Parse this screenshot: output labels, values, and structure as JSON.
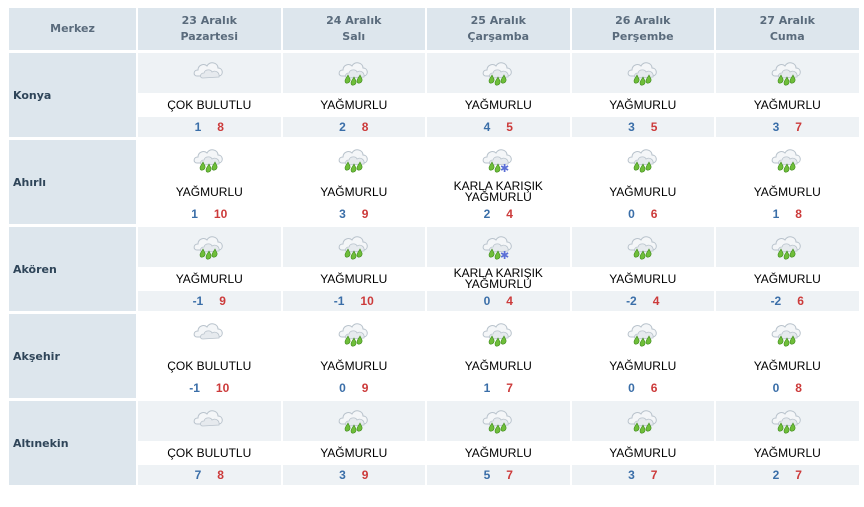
{
  "header": {
    "region": "Merkez",
    "days": [
      {
        "date": "23 Aralık",
        "weekday": "Pazartesi"
      },
      {
        "date": "24 Aralık",
        "weekday": "Salı"
      },
      {
        "date": "25 Aralık",
        "weekday": "Çarşamba"
      },
      {
        "date": "26 Aralık",
        "weekday": "Perşembe"
      },
      {
        "date": "27 Aralık",
        "weekday": "Cuma"
      }
    ]
  },
  "colors": {
    "header_bg": "#dde6ed",
    "shade_bg": "#eef2f5",
    "min": "#3a6ea8",
    "max": "#cc3a3a"
  },
  "rows": [
    {
      "name": "Konya",
      "days": [
        {
          "icon": "cloudy-icon",
          "condition": "ÇOK BULUTLU",
          "min": "1",
          "max": "8"
        },
        {
          "icon": "rain-icon",
          "condition": "YAĞMURLU",
          "min": "2",
          "max": "8"
        },
        {
          "icon": "rain-icon",
          "condition": "YAĞMURLU",
          "min": "4",
          "max": "5"
        },
        {
          "icon": "rain-icon",
          "condition": "YAĞMURLU",
          "min": "3",
          "max": "5"
        },
        {
          "icon": "rain-icon",
          "condition": "YAĞMURLU",
          "min": "3",
          "max": "7"
        }
      ]
    },
    {
      "name": "Ahırlı",
      "days": [
        {
          "icon": "rain-icon",
          "condition": "YAĞMURLU",
          "min": "1",
          "max": "10"
        },
        {
          "icon": "rain-icon",
          "condition": "YAĞMURLU",
          "min": "3",
          "max": "9"
        },
        {
          "icon": "sleet-icon",
          "condition": "KARLA KARIŞIK YAĞMURLU",
          "min": "2",
          "max": "4"
        },
        {
          "icon": "rain-icon",
          "condition": "YAĞMURLU",
          "min": "0",
          "max": "6"
        },
        {
          "icon": "rain-icon",
          "condition": "YAĞMURLU",
          "min": "1",
          "max": "8"
        }
      ]
    },
    {
      "name": "Akören",
      "days": [
        {
          "icon": "rain-icon",
          "condition": "YAĞMURLU",
          "min": "-1",
          "max": "9"
        },
        {
          "icon": "rain-icon",
          "condition": "YAĞMURLU",
          "min": "-1",
          "max": "10"
        },
        {
          "icon": "sleet-icon",
          "condition": "KARLA KARIŞIK YAĞMURLU",
          "min": "0",
          "max": "4"
        },
        {
          "icon": "rain-icon",
          "condition": "YAĞMURLU",
          "min": "-2",
          "max": "4"
        },
        {
          "icon": "rain-icon",
          "condition": "YAĞMURLU",
          "min": "-2",
          "max": "6"
        }
      ]
    },
    {
      "name": "Akşehir",
      "days": [
        {
          "icon": "cloudy-icon",
          "condition": "ÇOK BULUTLU",
          "min": "-1",
          "max": "10"
        },
        {
          "icon": "rain-icon",
          "condition": "YAĞMURLU",
          "min": "0",
          "max": "9"
        },
        {
          "icon": "rain-icon",
          "condition": "YAĞMURLU",
          "min": "1",
          "max": "7"
        },
        {
          "icon": "rain-icon",
          "condition": "YAĞMURLU",
          "min": "0",
          "max": "6"
        },
        {
          "icon": "rain-icon",
          "condition": "YAĞMURLU",
          "min": "0",
          "max": "8"
        }
      ]
    },
    {
      "name": "Altınekin",
      "days": [
        {
          "icon": "cloudy-icon",
          "condition": "ÇOK BULUTLU",
          "min": "7",
          "max": "8"
        },
        {
          "icon": "rain-icon",
          "condition": "YAĞMURLU",
          "min": "3",
          "max": "9"
        },
        {
          "icon": "rain-icon",
          "condition": "YAĞMURLU",
          "min": "5",
          "max": "7"
        },
        {
          "icon": "rain-icon",
          "condition": "YAĞMURLU",
          "min": "3",
          "max": "7"
        },
        {
          "icon": "rain-icon",
          "condition": "YAĞMURLU",
          "min": "2",
          "max": "7"
        }
      ]
    }
  ]
}
